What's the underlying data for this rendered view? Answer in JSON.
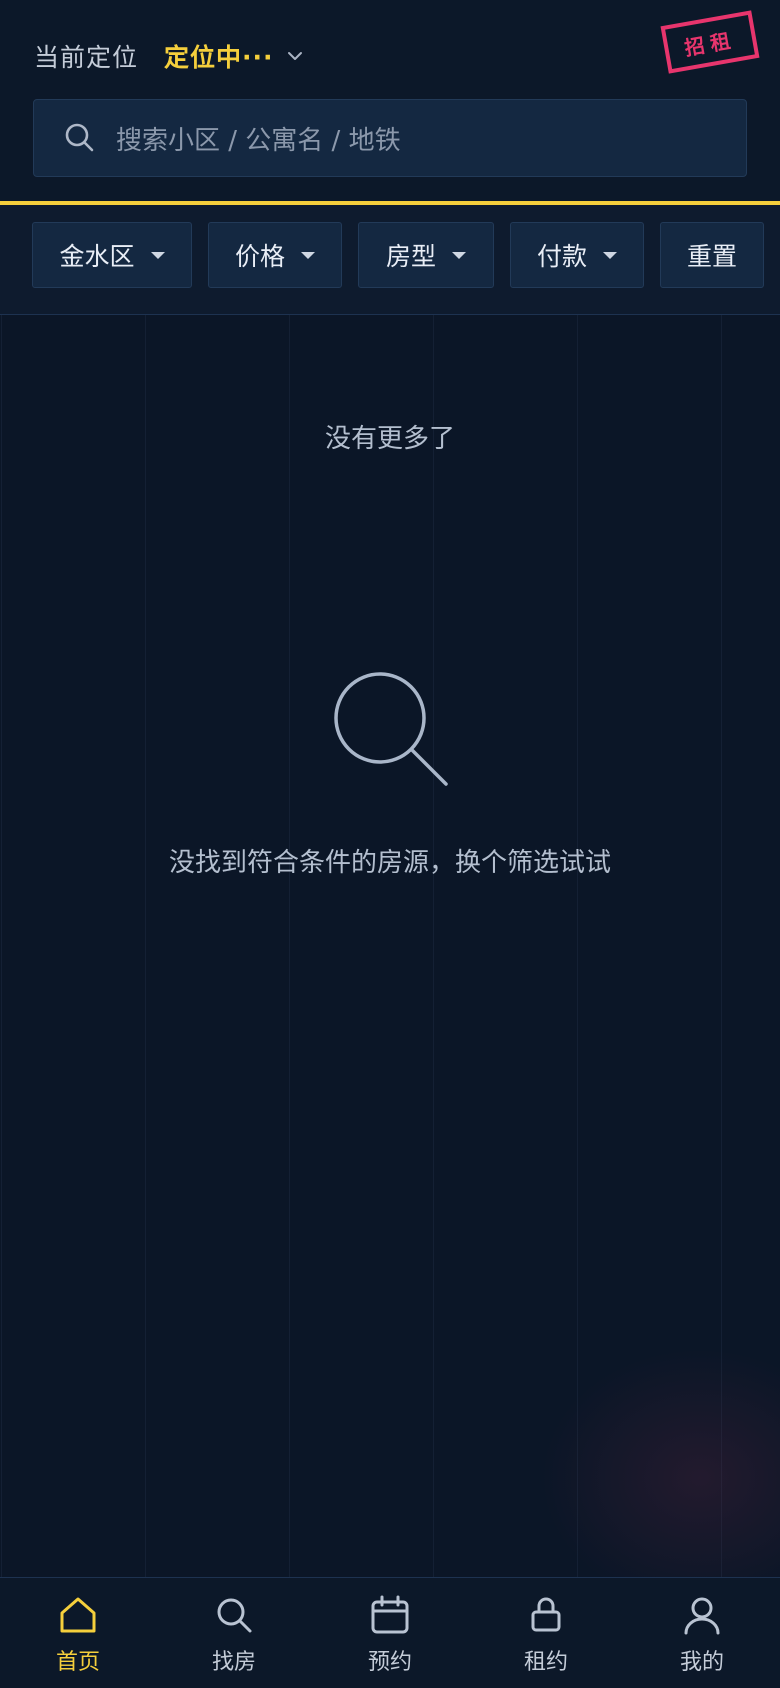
{
  "header": {
    "location_label": "当前定位",
    "location_value": "定位中···",
    "stamp_text": "招租",
    "search_placeholder": "搜索小区 / 公寓名 / 地铁"
  },
  "filters": {
    "district": "金水区",
    "price": "价格",
    "room_type": "房型",
    "payment": "付款",
    "reset": "重置"
  },
  "content": {
    "no_more": "没有更多了",
    "empty_message": "没找到符合条件的房源，换个筛选试试"
  },
  "bottom_nav": {
    "home": "首页",
    "find": "找房",
    "booking": "预约",
    "lease": "租约",
    "mine": "我的"
  },
  "colors": {
    "accent": "#f5cf3c",
    "stamp": "#e8356d",
    "background": "#0b1627"
  }
}
